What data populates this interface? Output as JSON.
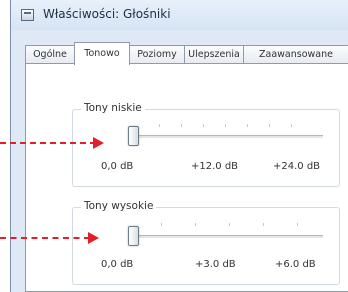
{
  "window": {
    "title": "Właściwości: Głośniki",
    "icon": "speaker-properties-icon"
  },
  "tabs": [
    {
      "label": "Ogólne",
      "active": false
    },
    {
      "label": "Tonowo",
      "active": true
    },
    {
      "label": "Poziomy",
      "active": false
    },
    {
      "label": "Ulepszenia",
      "active": false
    },
    {
      "label": "Zaawansowane",
      "active": false
    }
  ],
  "bass": {
    "title": "Tony niskie",
    "level": 0,
    "scale": [
      "0,0 dB",
      "+12.0 dB",
      "+24.0 dB"
    ]
  },
  "treble": {
    "title": "Tony wysokie",
    "level": 0,
    "scale": [
      "0,0 dB",
      "+3.0 dB",
      "+6.0 dB"
    ]
  },
  "annotations": {
    "arrow_color": "#e0202a"
  }
}
